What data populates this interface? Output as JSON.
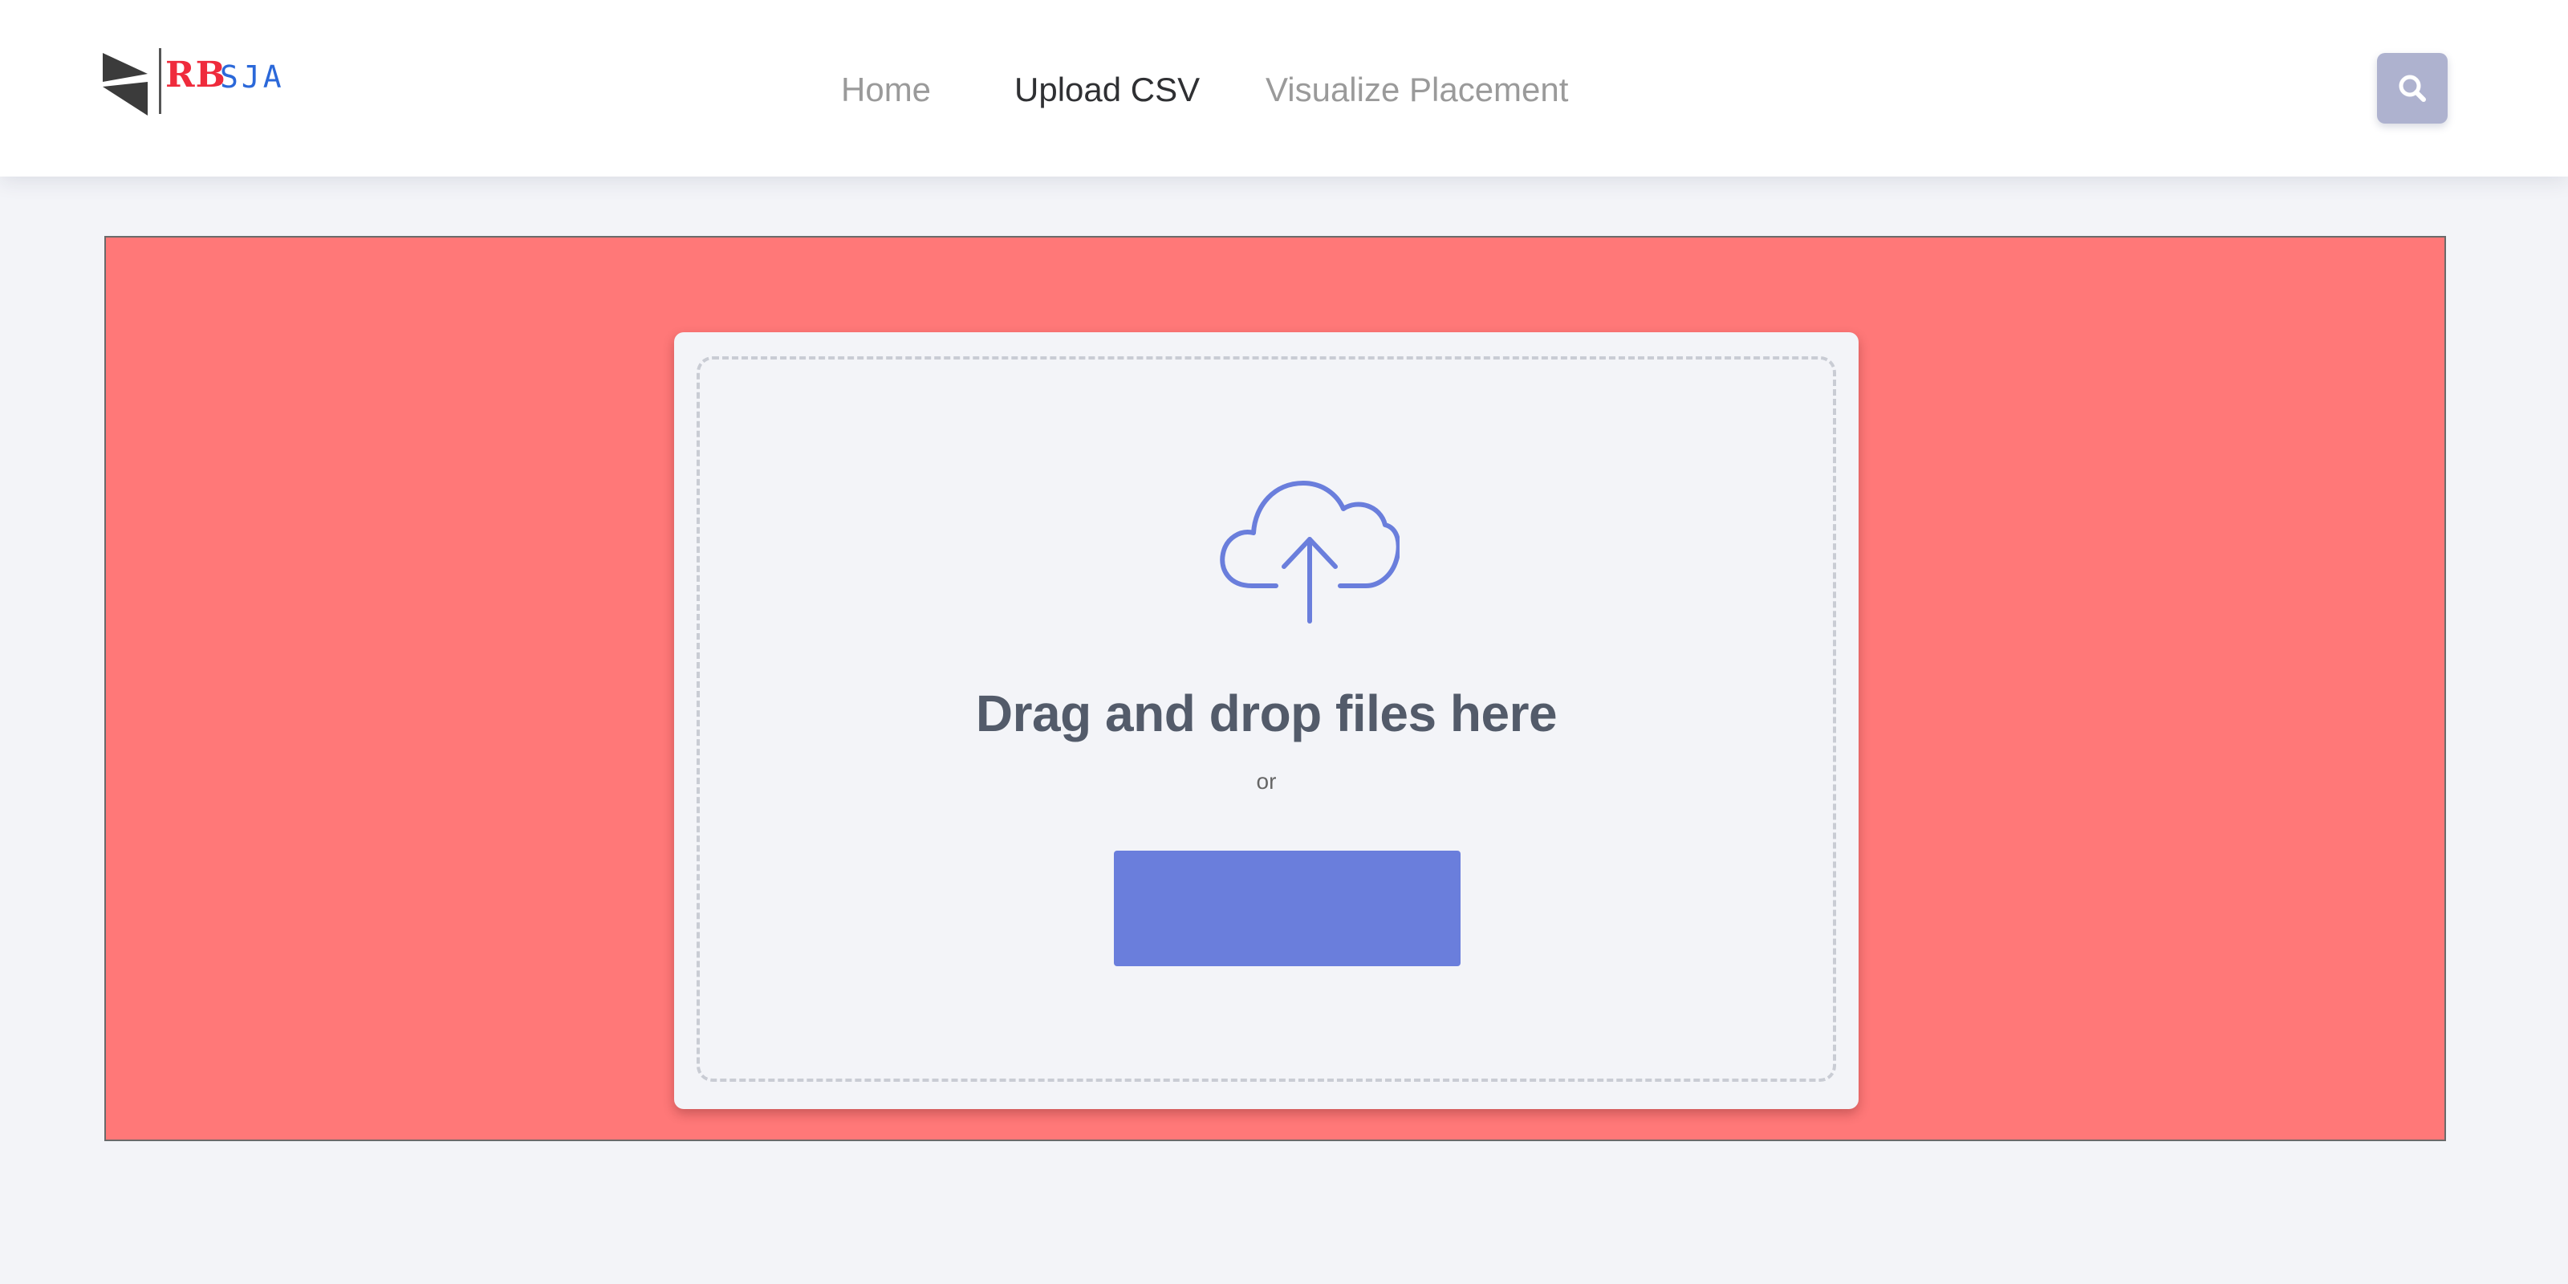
{
  "brand": {
    "logo_red": "RB",
    "logo_blue": "SJA"
  },
  "nav": {
    "items": [
      {
        "label": "Home",
        "active": false
      },
      {
        "label": "Upload CSV",
        "active": true
      },
      {
        "label": "Visualize Placement",
        "active": false
      }
    ]
  },
  "search": {
    "icon": "search-icon"
  },
  "upload": {
    "icon": "cloud-upload-icon",
    "headline": "Drag and drop files here",
    "or_text": "or",
    "button_label": ""
  },
  "colors": {
    "drop_region_bg": "#ff7878",
    "accent": "#6a7edc",
    "search_button": "#aeb2cf"
  }
}
